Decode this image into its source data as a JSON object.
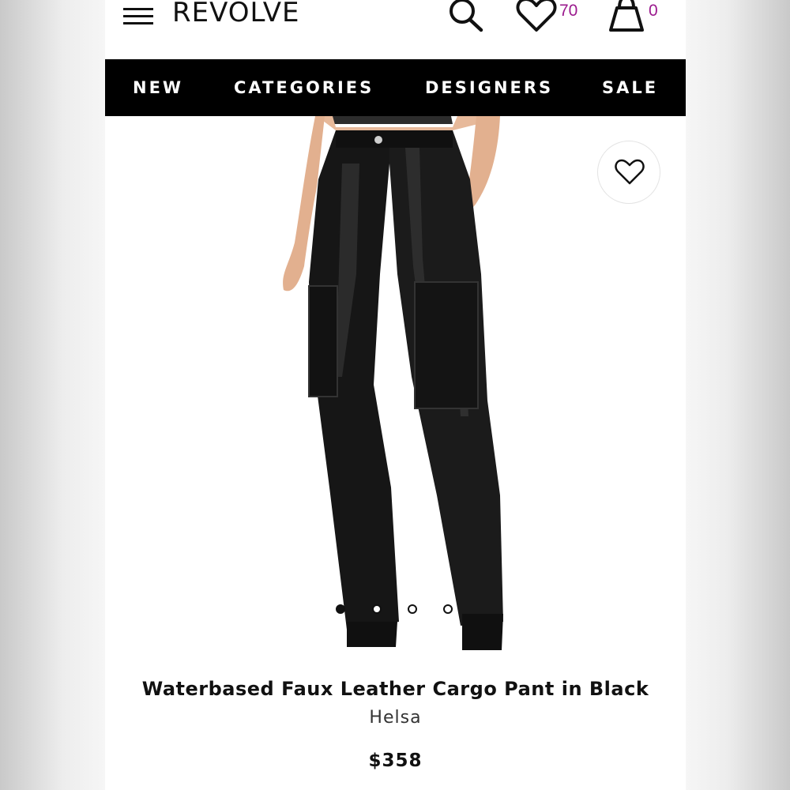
{
  "header": {
    "logo": "REVOLVE",
    "wishlist_count": "70",
    "bag_count": "0"
  },
  "nav": {
    "items": [
      "NEW",
      "CATEGORIES",
      "DESIGNERS",
      "SALE"
    ]
  },
  "gallery": {
    "image_count": 4,
    "active_index": 0
  },
  "product": {
    "title": "Waterbased Faux Leather Cargo Pant in Black",
    "brand": "Helsa",
    "price": "$358"
  },
  "colors": {
    "accent_count": "#9b1a8e",
    "nav_bg": "#000000",
    "text": "#111111"
  },
  "icons": [
    "menu-icon",
    "search-icon",
    "heart-icon",
    "shopping-bag-icon",
    "favorite-heart-icon"
  ]
}
